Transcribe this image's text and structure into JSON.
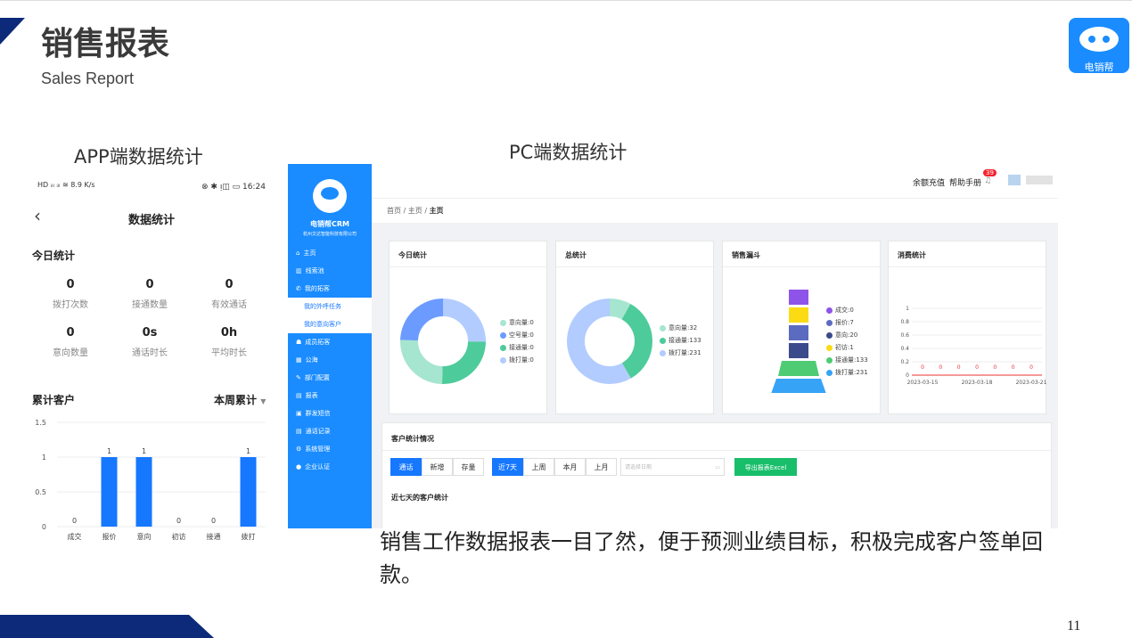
{
  "slide": {
    "title": "销售报表",
    "subtitle": "Sales Report",
    "app_label": "APP端数据统计",
    "pc_label": "PC端数据统计",
    "caption": "销售工作数据报表一目了然，便于预测业绩目标，积极完成客户签单回款。",
    "page_number": "11",
    "logo_text": "电销帮"
  },
  "phone": {
    "status_left": "HD ᵢₗₗ ᵢₗₗ ≋ 8.9 K/s",
    "status_right": "⊗ ✱ ᴉ◫ ▭ 16:24",
    "title": "数据统计",
    "today_title": "今日统计",
    "stats": [
      {
        "value": "0",
        "label": "拨打次数"
      },
      {
        "value": "0",
        "label": "接通数量"
      },
      {
        "value": "0",
        "label": "有效通话"
      },
      {
        "value": "0",
        "label": "意向数量"
      },
      {
        "value": "0s",
        "label": "通话时长"
      },
      {
        "value": "0h",
        "label": "平均时长"
      }
    ],
    "cum_title": "累计客户",
    "range_select": "本周累计"
  },
  "chart_data": {
    "type": "bar",
    "categories": [
      "成交",
      "报价",
      "意向",
      "初访",
      "接通",
      "拨打"
    ],
    "values": [
      0,
      1,
      1,
      0,
      0,
      1
    ],
    "ylim": [
      0,
      1.5
    ],
    "yticks": [
      "0",
      "0.5",
      "1",
      "1.5"
    ],
    "color": "#1677ff"
  },
  "pc": {
    "brand": "电销帮CRM",
    "company": "杭州文达智能科技有限公司",
    "menu": [
      "主页",
      "线索池",
      "我的拓客",
      "我的外呼任务",
      "我的意向客户",
      "成员拓客",
      "公海",
      "部门配置",
      "报表",
      "群发短信",
      "通话记录",
      "系统管理",
      "企业认证"
    ],
    "topbar": {
      "recharge": "余额充值",
      "manual": "帮助手册",
      "badge": "39"
    },
    "breadcrumb": [
      "首页",
      "主页",
      "主页"
    ],
    "cards": {
      "today": {
        "title": "今日统计",
        "legend": [
          "意向量:0",
          "空号量:0",
          "接通量:0",
          "拨打量:0"
        ]
      },
      "total": {
        "title": "总统计",
        "legend": [
          "意向量:32",
          "接通量:133",
          "拨打量:231"
        ],
        "values": [
          32,
          133,
          231
        ]
      },
      "funnel": {
        "title": "销售漏斗",
        "legend": [
          "成交:0",
          "报价:7",
          "意向:20",
          "初访:1",
          "接通量:133",
          "拨打量:231"
        ]
      },
      "cost": {
        "title": "消费统计",
        "yticks": [
          "0",
          "0.2",
          "0.4",
          "0.6",
          "0.8",
          "1"
        ],
        "x": [
          "2023-03-15",
          "2023-03-18",
          "2023-03-21"
        ],
        "point_labels": [
          "0",
          "0",
          "0",
          "0",
          "0",
          "0",
          "0"
        ]
      }
    },
    "customer": {
      "title": "客户统计情况",
      "tabs1": [
        "通话",
        "新增",
        "存量"
      ],
      "tabs2": [
        "近7天",
        "上周",
        "本月",
        "上月"
      ],
      "date_placeholder": "请选择日期",
      "export": "导出报表Excel",
      "sub": "近七天的客户统计"
    }
  },
  "colors": {
    "blue": "#1a8cff",
    "navy": "#0d2a7a",
    "green": "#19be6b",
    "teal": "#4ecb9b",
    "lightblue": "#b2ccff",
    "midblue": "#6b9bff",
    "mint": "#a6e5cf"
  }
}
